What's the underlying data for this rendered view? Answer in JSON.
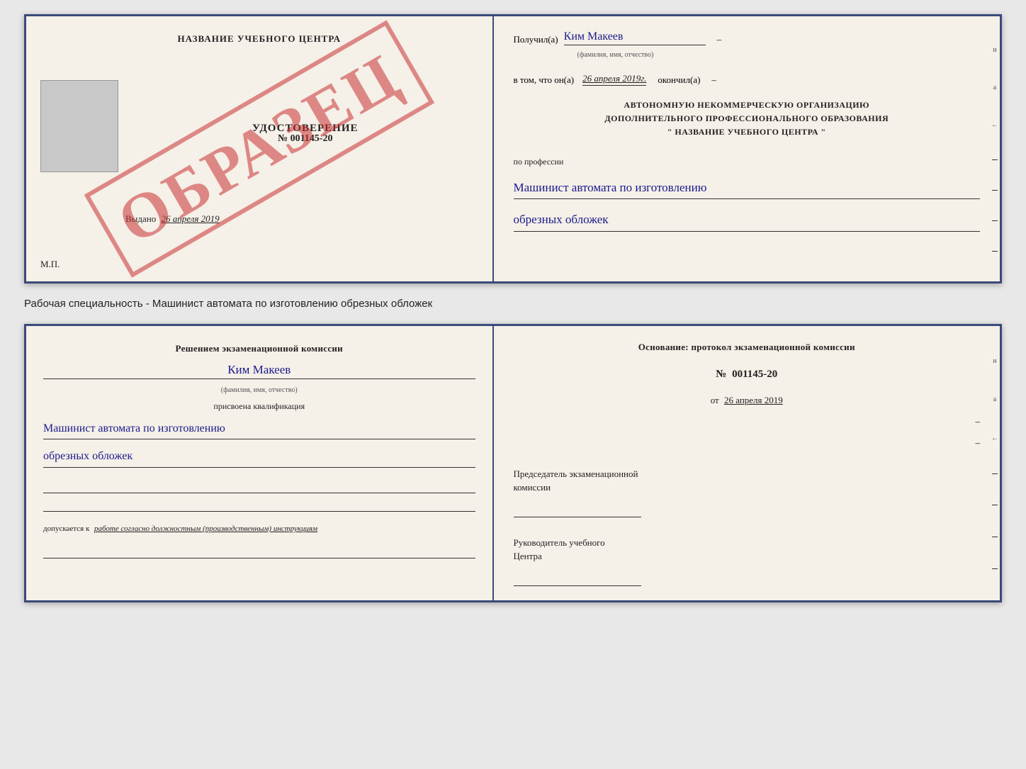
{
  "top_left": {
    "school_name": "НАЗВАНИЕ УЧЕБНОГО ЦЕНТРА",
    "cert_title": "УДОСТОВЕРЕНИЕ",
    "cert_number": "№ 001145-20",
    "issued_label": "Выдано",
    "issued_date": "26 апреля 2019",
    "mp_label": "М.П.",
    "watermark": "ОБРАЗЕЦ"
  },
  "top_right": {
    "received_label": "Получил(а)",
    "received_name": "Ким Макеев",
    "name_subtext": "(фамилия, имя, отчество)",
    "dash1": "–",
    "inthat_label": "в том, что он(а)",
    "inthat_date": "26 апреля 2019г.",
    "finished_label": "окончил(а)",
    "dash2": "–",
    "org_line1": "АВТОНОМНУЮ НЕКОММЕРЧЕСКУЮ ОРГАНИЗАЦИЮ",
    "org_line2": "ДОПОЛНИТЕЛЬНОГО ПРОФЕССИОНАЛЬНОГО ОБРАЗОВАНИЯ",
    "org_line3": "\"  НАЗВАНИЕ УЧЕБНОГО ЦЕНТРА  \"",
    "dash3": "–",
    "side_chars": [
      "и",
      "а",
      "←",
      "–",
      "–",
      "–",
      "–"
    ],
    "profession_label": "по профессии",
    "profession_value1": "Машинист автомата по изготовлению",
    "profession_value2": "обрезных обложек",
    "dashes_right": [
      "–",
      "–",
      "–",
      "–",
      "–",
      "–"
    ]
  },
  "description": "Рабочая специальность - Машинист автомата по изготовлению обрезных обложек",
  "bottom_left": {
    "komissia_line1": "Решением экзаменационной комиссии",
    "name_value": "Ким Макеев",
    "name_subtext": "(фамилия, имя, отчество)",
    "prisvoena": "присвоена квалификация",
    "qualification1": "Машинист автомата по изготовлению",
    "qualification2": "обрезных обложек",
    "dopuskaetsya_label": "допускается к",
    "dopuskaetsya_value": "работе согласно должностным (производственным) инструкциям"
  },
  "bottom_right": {
    "osnovanie_line1": "Основание: протокол экзаменационной комиссии",
    "number_prefix": "№",
    "number_value": "001145-20",
    "date_prefix": "от",
    "date_value": "26 апреля 2019",
    "dash1": "–",
    "dash2": "–",
    "dash3": "–",
    "predsedatel_label": "Председатель экзаменационной",
    "komissia_label": "комиссии",
    "rukovoditel_label": "Руководитель учебного",
    "tsentra_label": "Центра",
    "side_chars": [
      "и",
      "а",
      "←",
      "–",
      "–",
      "–",
      "–"
    ]
  }
}
